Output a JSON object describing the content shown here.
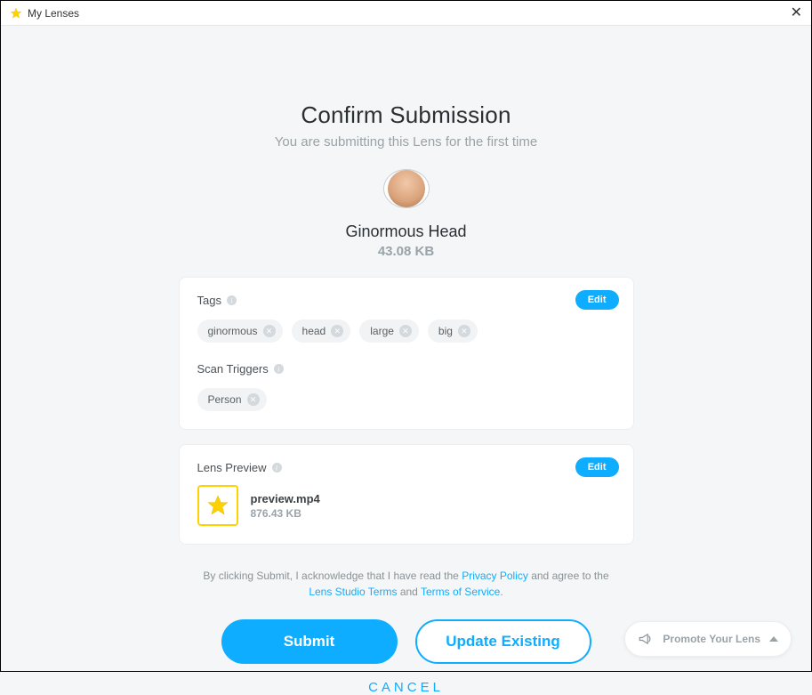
{
  "window": {
    "title": "My Lenses"
  },
  "header": {
    "title": "Confirm Submission",
    "subtitle": "You are submitting this Lens for the first time"
  },
  "lens": {
    "name": "Ginormous Head",
    "size": "43.08 KB"
  },
  "tags_section": {
    "label": "Tags",
    "edit": "Edit",
    "tags": [
      "ginormous",
      "head",
      "large",
      "big"
    ]
  },
  "scan_section": {
    "label": "Scan Triggers",
    "triggers": [
      "Person"
    ]
  },
  "preview_section": {
    "label": "Lens Preview",
    "edit": "Edit",
    "file": {
      "name": "preview.mp4",
      "size": "876.43 KB"
    }
  },
  "legal": {
    "prefix": "By clicking Submit, I acknowledge that I have read the ",
    "privacy": "Privacy Policy",
    "mid1": " and agree to the ",
    "terms1": "Lens Studio Terms",
    "mid2": " and ",
    "terms2": "Terms of Service",
    "suffix": "."
  },
  "buttons": {
    "submit": "Submit",
    "update": "Update Existing",
    "cancel": "CANCEL"
  },
  "promote": {
    "label": "Promote Your Lens"
  }
}
